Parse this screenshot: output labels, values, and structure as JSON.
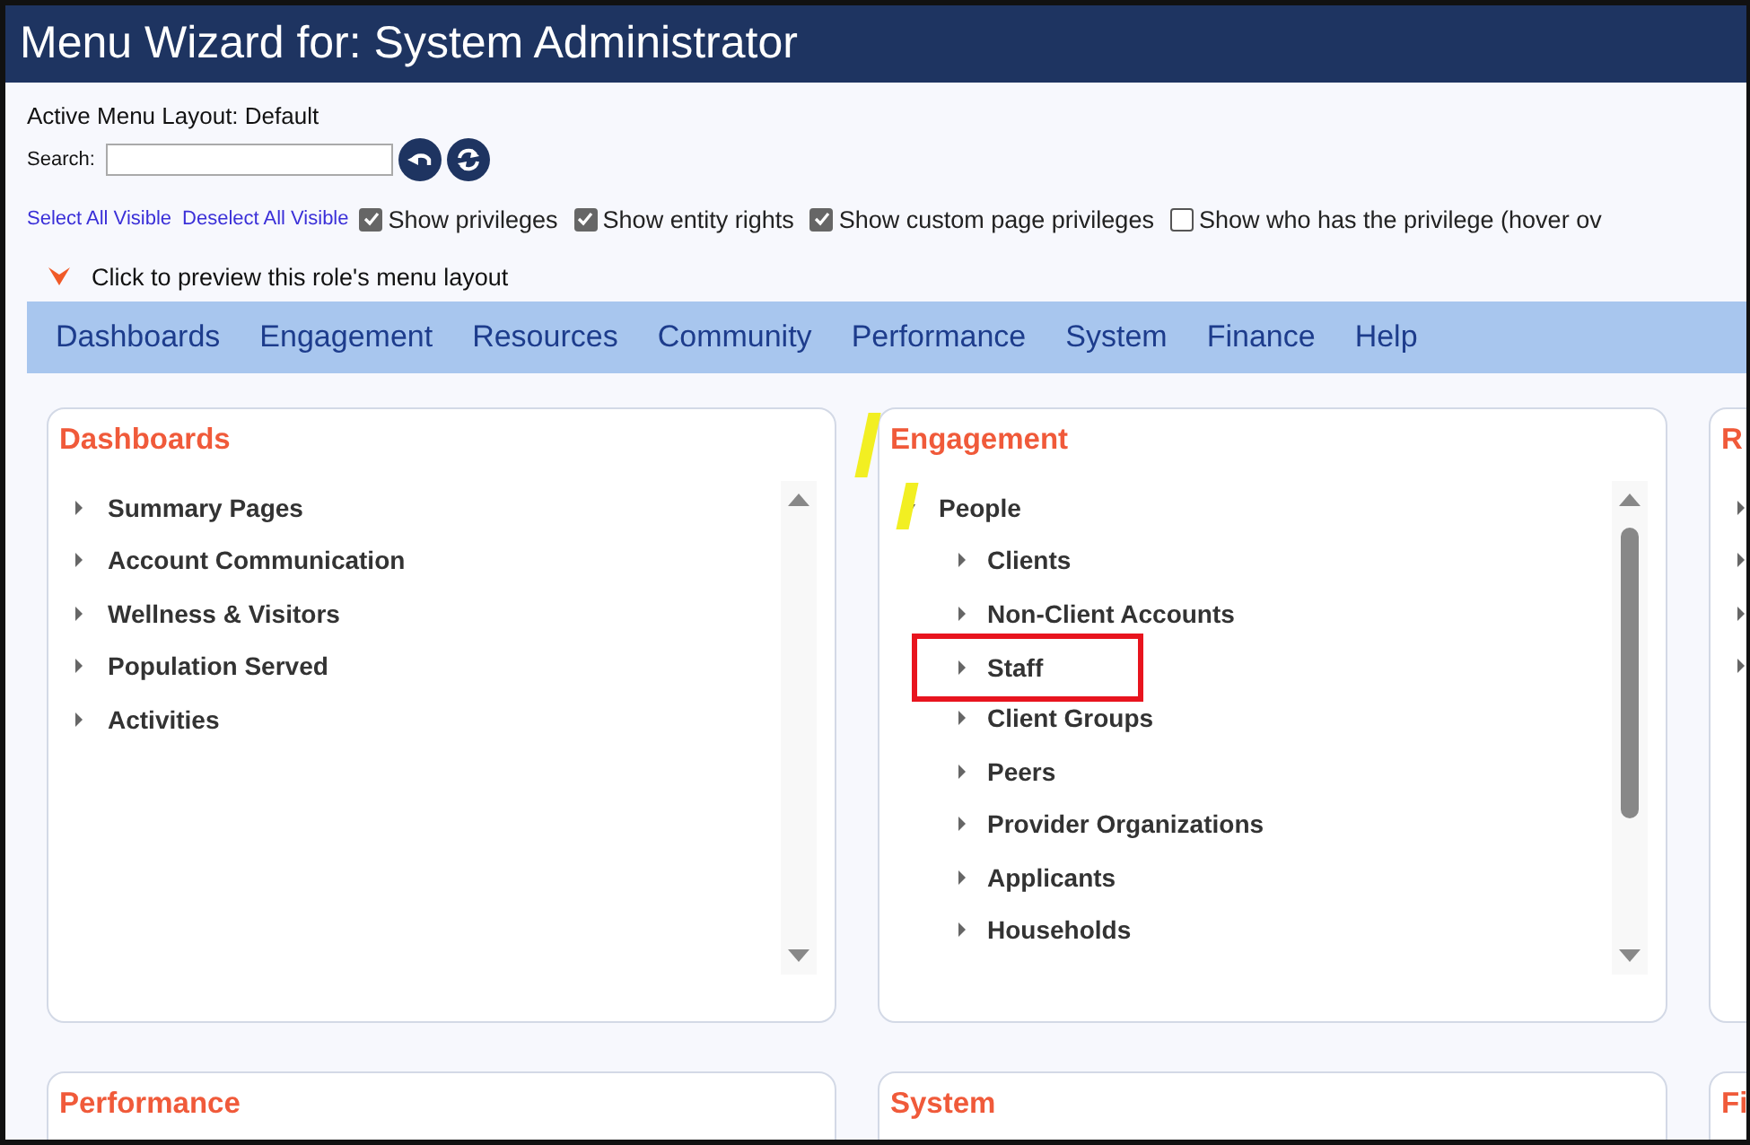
{
  "window": {
    "title": "Menu Wizard for: System Administrator"
  },
  "active_layout": "Active Menu Layout: Default",
  "search": {
    "label": "Search:"
  },
  "links": [
    "Select All Visible",
    "Deselect All Visible"
  ],
  "options": [
    {
      "label": "Show privileges",
      "checked": true
    },
    {
      "label": "Show entity rights",
      "checked": true
    },
    {
      "label": "Show custom page privileges",
      "checked": true
    },
    {
      "label": "Show who has the privilege (hover ov",
      "checked": false
    }
  ],
  "preview": {
    "label": "Click to preview this role's menu layout",
    "expanded": true
  },
  "nav": [
    "Dashboards",
    "Engagement",
    "Resources",
    "Community",
    "Performance",
    "System",
    "Finance",
    "Help"
  ],
  "panels": [
    {
      "title": "Dashboards",
      "items": [
        {
          "label": "Summary Pages",
          "expanded": false
        },
        {
          "label": "Account Communication",
          "expanded": false
        },
        {
          "label": "Wellness & Visitors",
          "expanded": false
        },
        {
          "label": "Population Served",
          "expanded": false
        },
        {
          "label": "Activities",
          "expanded": false
        }
      ]
    },
    {
      "title": "Engagement",
      "marked": true,
      "scroll_thumb": true,
      "items": [
        {
          "label": "People",
          "expanded": true,
          "marked": true,
          "children": [
            {
              "label": "Clients",
              "expanded": false
            },
            {
              "label": "Non-Client Accounts",
              "expanded": false
            },
            {
              "label": "Staff",
              "expanded": false,
              "boxed": true
            },
            {
              "label": "Client Groups",
              "expanded": false
            },
            {
              "label": "Peers",
              "expanded": false
            },
            {
              "label": "Provider Organizations",
              "expanded": false
            },
            {
              "label": "Applicants",
              "expanded": false
            },
            {
              "label": "Households",
              "expanded": false
            }
          ]
        }
      ]
    },
    {
      "title": "R",
      "items": [
        {
          "expanded": false
        },
        {
          "expanded": false
        },
        {
          "expanded": false
        },
        {
          "expanded": false
        }
      ]
    }
  ],
  "lower_panels": [
    "Performance",
    "System",
    "Fi"
  ]
}
